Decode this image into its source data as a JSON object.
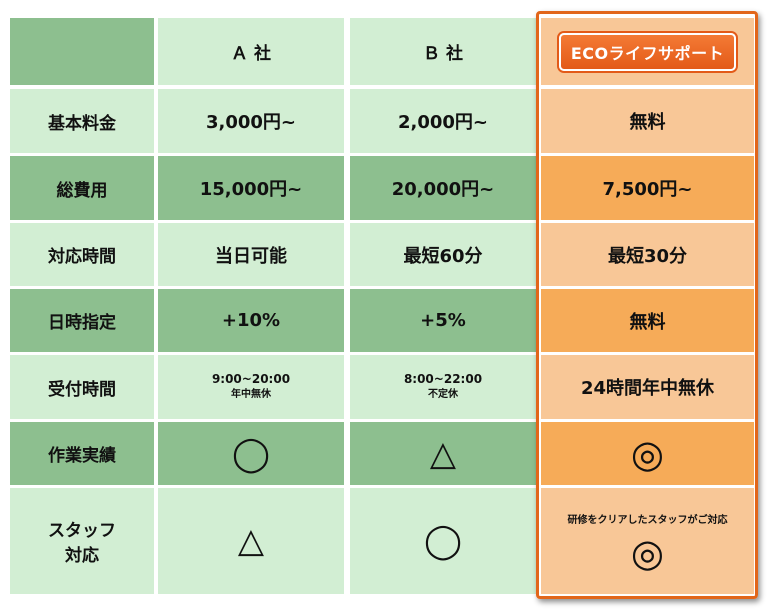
{
  "header": {
    "blank": "",
    "company_a": "Ａ 社",
    "company_b": "Ｂ 社",
    "eco": "ECOライフサポート"
  },
  "rows": [
    {
      "label": "基本料金",
      "a": "3,000円~",
      "b": "2,000円~",
      "eco": "無料"
    },
    {
      "label": "総費用",
      "a": "15,000円~",
      "b": "20,000円~",
      "eco": "7,500円~"
    },
    {
      "label": "対応時間",
      "a": "当日可能",
      "b": "最短60分",
      "eco": "最短30分"
    },
    {
      "label": "日時指定",
      "a": "+10%",
      "b": "+5%",
      "eco": "無料"
    },
    {
      "label": "受付時間",
      "a": "9:00~20:00",
      "a_sub": "年中無休",
      "b": "8:00~22:00",
      "b_sub": "不定休",
      "eco": "24時間年中無休"
    },
    {
      "label": "作業実績",
      "a": "◯",
      "b": "△",
      "eco": "◎"
    },
    {
      "label_line1": "スタッフ",
      "label_line2": "対応",
      "a": "△",
      "b": "◯",
      "eco_note": "研修をクリアしたスタッフがご対応",
      "eco": "◎"
    }
  ],
  "colors": {
    "green_dark": "#8dbf8f",
    "green_light": "#d2eed3",
    "orange_dark": "#f6ab58",
    "orange_light": "#f8c797",
    "orange_border": "#e2661a"
  }
}
